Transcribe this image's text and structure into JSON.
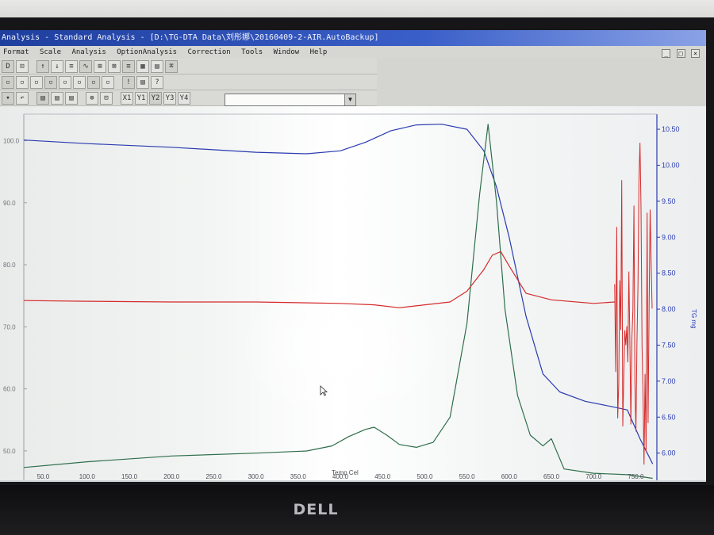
{
  "window": {
    "title": "Analysis - Standard Analysis - [D:\\TG-DTA Data\\刘彤娜\\20160409-2-AIR.AutoBackup]",
    "controls": [
      "_",
      "□",
      "×"
    ]
  },
  "menu": [
    "Format",
    "Scale",
    "Analysis",
    "OptionAnalysis",
    "Correction",
    "Tools",
    "Window",
    "Help"
  ],
  "toolbar": {
    "rows": [
      [
        "D",
        "⊡",
        "",
        "↑",
        "↓",
        "≡",
        "∿",
        "⊞",
        "⊠",
        "≡",
        "▦",
        "▤",
        "⌘"
      ],
      [
        "▫",
        "▫",
        "▫",
        "▫",
        "▫",
        "▫",
        "▫",
        "▫",
        "",
        "!",
        "▤",
        "?"
      ],
      [
        "▾",
        "↶",
        "",
        "▤",
        "▤",
        "▤",
        "",
        "⊕",
        "⊡",
        "",
        "X1",
        "Y1",
        "Y2",
        "Y3",
        "Y4"
      ]
    ],
    "combo_value": ""
  },
  "chart_data": {
    "type": "line",
    "xlabel": "Temp Cel",
    "xlim": [
      25,
      775
    ],
    "x_ticks": [
      50,
      100,
      150,
      200,
      250,
      300,
      350,
      400,
      450,
      500,
      550,
      600,
      650,
      700,
      750
    ],
    "x_tick_labels": [
      "50.0",
      "100.0",
      "150.0",
      "200.0",
      "250.0",
      "300.0",
      "350.0",
      "400.0",
      "450.0",
      "500.0",
      "550.0",
      "600.0",
      "650.0",
      "700.0",
      "750.0"
    ],
    "left_axis": {
      "ylim": [
        45,
        103
      ],
      "ticks": [
        100,
        90,
        80,
        70,
        60,
        50
      ],
      "tick_labels": [
        "100.0",
        "90.0",
        "80.0",
        "70.0",
        "60.0",
        "50.0"
      ]
    },
    "right_axis": {
      "label": "TG mg",
      "ylim": [
        5.6,
        10.6
      ],
      "ticks": [
        10.5,
        10,
        9.5,
        9,
        8.5,
        8,
        7.5,
        7,
        6.5,
        6
      ],
      "tick_labels": [
        "10.50",
        "10.00",
        "9.50",
        "9.00",
        "8.50",
        "8.00",
        "7.50",
        "7.00",
        "6.50",
        "6.00"
      ]
    },
    "series": [
      {
        "color": "#2a3bb0",
        "axis": "right",
        "x": [
          25,
          100,
          200,
          300,
          360,
          400,
          430,
          460,
          490,
          520,
          550,
          570,
          585,
          600,
          620,
          640,
          660,
          690,
          720,
          740,
          755,
          770
        ],
        "y": [
          10.35,
          10.3,
          10.25,
          10.18,
          10.16,
          10.2,
          10.32,
          10.48,
          10.56,
          10.57,
          10.5,
          10.2,
          9.7,
          9.0,
          7.9,
          7.1,
          6.85,
          6.72,
          6.65,
          6.6,
          6.2,
          5.85
        ]
      },
      {
        "color": "#2e6e4a",
        "axis": "right",
        "x": [
          25,
          100,
          200,
          300,
          360,
          390,
          410,
          430,
          440,
          455,
          470,
          490,
          510,
          530,
          550,
          565,
          575,
          585,
          595,
          610,
          625,
          640,
          650,
          665,
          700,
          740,
          770
        ],
        "y": [
          5.8,
          5.88,
          5.96,
          6.0,
          6.03,
          6.1,
          6.23,
          6.33,
          6.36,
          6.25,
          6.12,
          6.08,
          6.15,
          6.5,
          7.8,
          9.6,
          10.57,
          9.5,
          8.0,
          6.8,
          6.25,
          6.1,
          6.2,
          5.78,
          5.72,
          5.7,
          5.65
        ]
      },
      {
        "color": "#d62a2a",
        "axis": "right",
        "x": [
          25,
          100,
          200,
          300,
          400,
          440,
          470,
          500,
          530,
          550,
          570,
          580,
          590,
          600,
          620,
          650,
          700,
          725
        ],
        "y": [
          8.12,
          8.11,
          8.1,
          8.1,
          8.08,
          8.06,
          8.02,
          8.06,
          8.1,
          8.25,
          8.55,
          8.75,
          8.8,
          8.6,
          8.22,
          8.13,
          8.08,
          8.1
        ]
      }
    ]
  }
}
